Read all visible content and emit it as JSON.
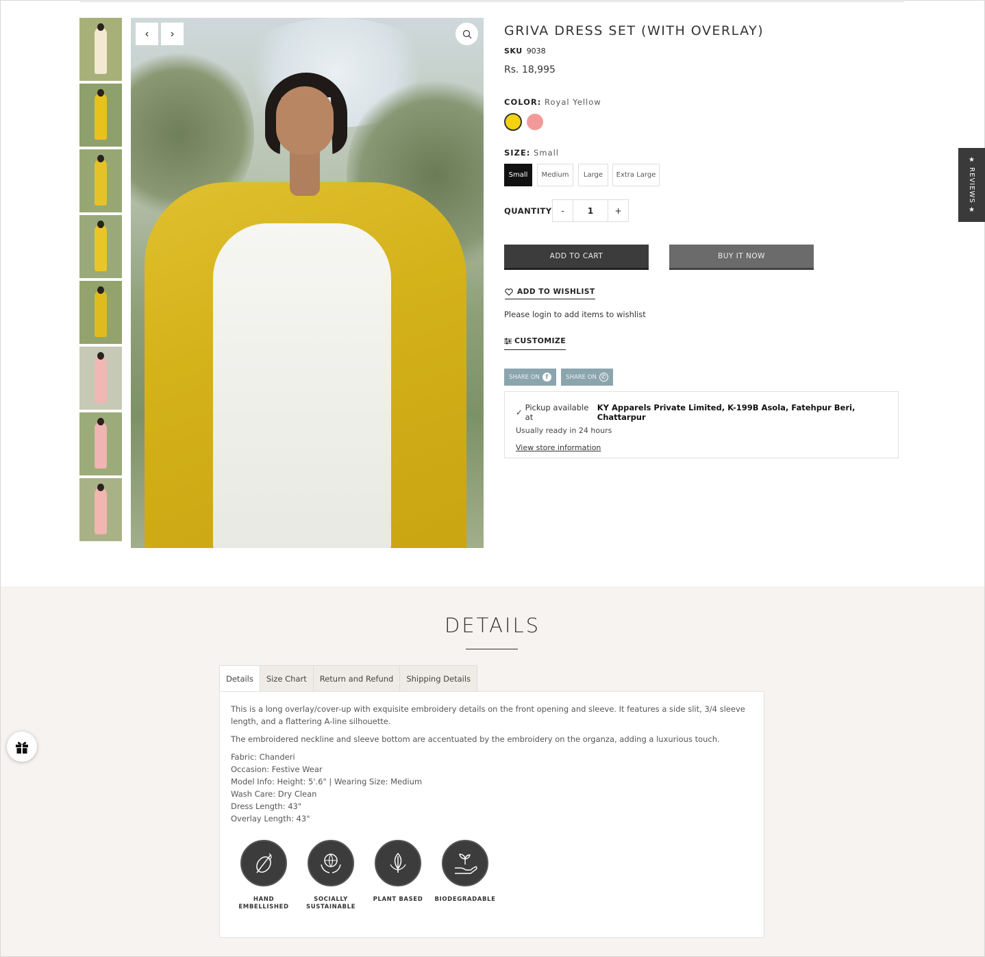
{
  "product": {
    "title": "GRIVA DRESS SET (WITH OVERLAY)",
    "sku_label": "SKU",
    "sku": "9038",
    "price": "Rs. 18,995"
  },
  "color": {
    "label": "COLOR:",
    "selected": "Royal Yellow",
    "swatches": [
      {
        "name": "Royal Yellow",
        "hex": "#f5d20f"
      },
      {
        "name": "Pink",
        "hex": "#f29a9a"
      }
    ]
  },
  "size": {
    "label": "SIZE:",
    "selected": "Small",
    "options": [
      "Small",
      "Medium",
      "Large",
      "Extra Large"
    ]
  },
  "quantity": {
    "label": "QUANTITY",
    "minus": "-",
    "value": "1",
    "plus": "+"
  },
  "actions": {
    "add_to_cart": "ADD TO CART",
    "buy_now": "BUY IT NOW",
    "wishlist": "ADD TO WISHLIST",
    "wishlist_note": "Please login to add items to wishlist",
    "customize": "CUSTOMIZE",
    "share_facebook": "SHARE ON",
    "share_whatsapp": "SHARE ON"
  },
  "pickup": {
    "prefix": "Pickup available at",
    "location": "KY Apparels Private Limited, K-199B Asola, Fatehpur Beri, Chattarpur",
    "ready": "Usually ready in 24 hours",
    "link": "View store information"
  },
  "reviews_tab": "★ REVIEWS ★",
  "details": {
    "heading": "DETAILS",
    "tabs": [
      "Details",
      "Size Chart",
      "Return and Refund",
      "Shipping Details"
    ],
    "paragraph1": "This is a long overlay/cover-up with exquisite embroidery details on the front opening and sleeve. It features a side slit, 3/4 sleeve length, and a flattering A-line silhouette.",
    "paragraph2": "The embroidered neckline and sleeve bottom are accentuated by the embroidery on the organza, adding a luxurious touch.",
    "specs": [
      "Fabric: Chanderi",
      "Occasion: Festive Wear",
      "Model Info: Height: 5'.6\" | Wearing Size: Medium",
      "Wash Care: Dry Clean",
      "Dress Length: 43\"",
      "Overlay Length: 43\""
    ],
    "badges": [
      {
        "label": "HAND EMBELLISHED",
        "icon": "needle-thread-icon"
      },
      {
        "label": "SOCIALLY SUSTAINABLE",
        "icon": "globe-hands-icon"
      },
      {
        "label": "PLANT BASED",
        "icon": "leaf-icon"
      },
      {
        "label": "BIODEGRADABLE",
        "icon": "sprout-hand-icon"
      }
    ]
  },
  "thumbnails": [
    {
      "bg": "#a8b07a",
      "fig": "#f3e9d0"
    },
    {
      "bg": "#8ea06b",
      "fig": "#e8c21c"
    },
    {
      "bg": "#97a774",
      "fig": "#e6c229"
    },
    {
      "bg": "#9aa97a",
      "fig": "#e9c628"
    },
    {
      "bg": "#93a36d",
      "fig": "#e0bb1f"
    },
    {
      "bg": "#c7c9b7",
      "fig": "#f0b7b4"
    },
    {
      "bg": "#9bab79",
      "fig": "#f0b4b2"
    },
    {
      "bg": "#a9b287",
      "fig": "#f1b6b0"
    }
  ]
}
